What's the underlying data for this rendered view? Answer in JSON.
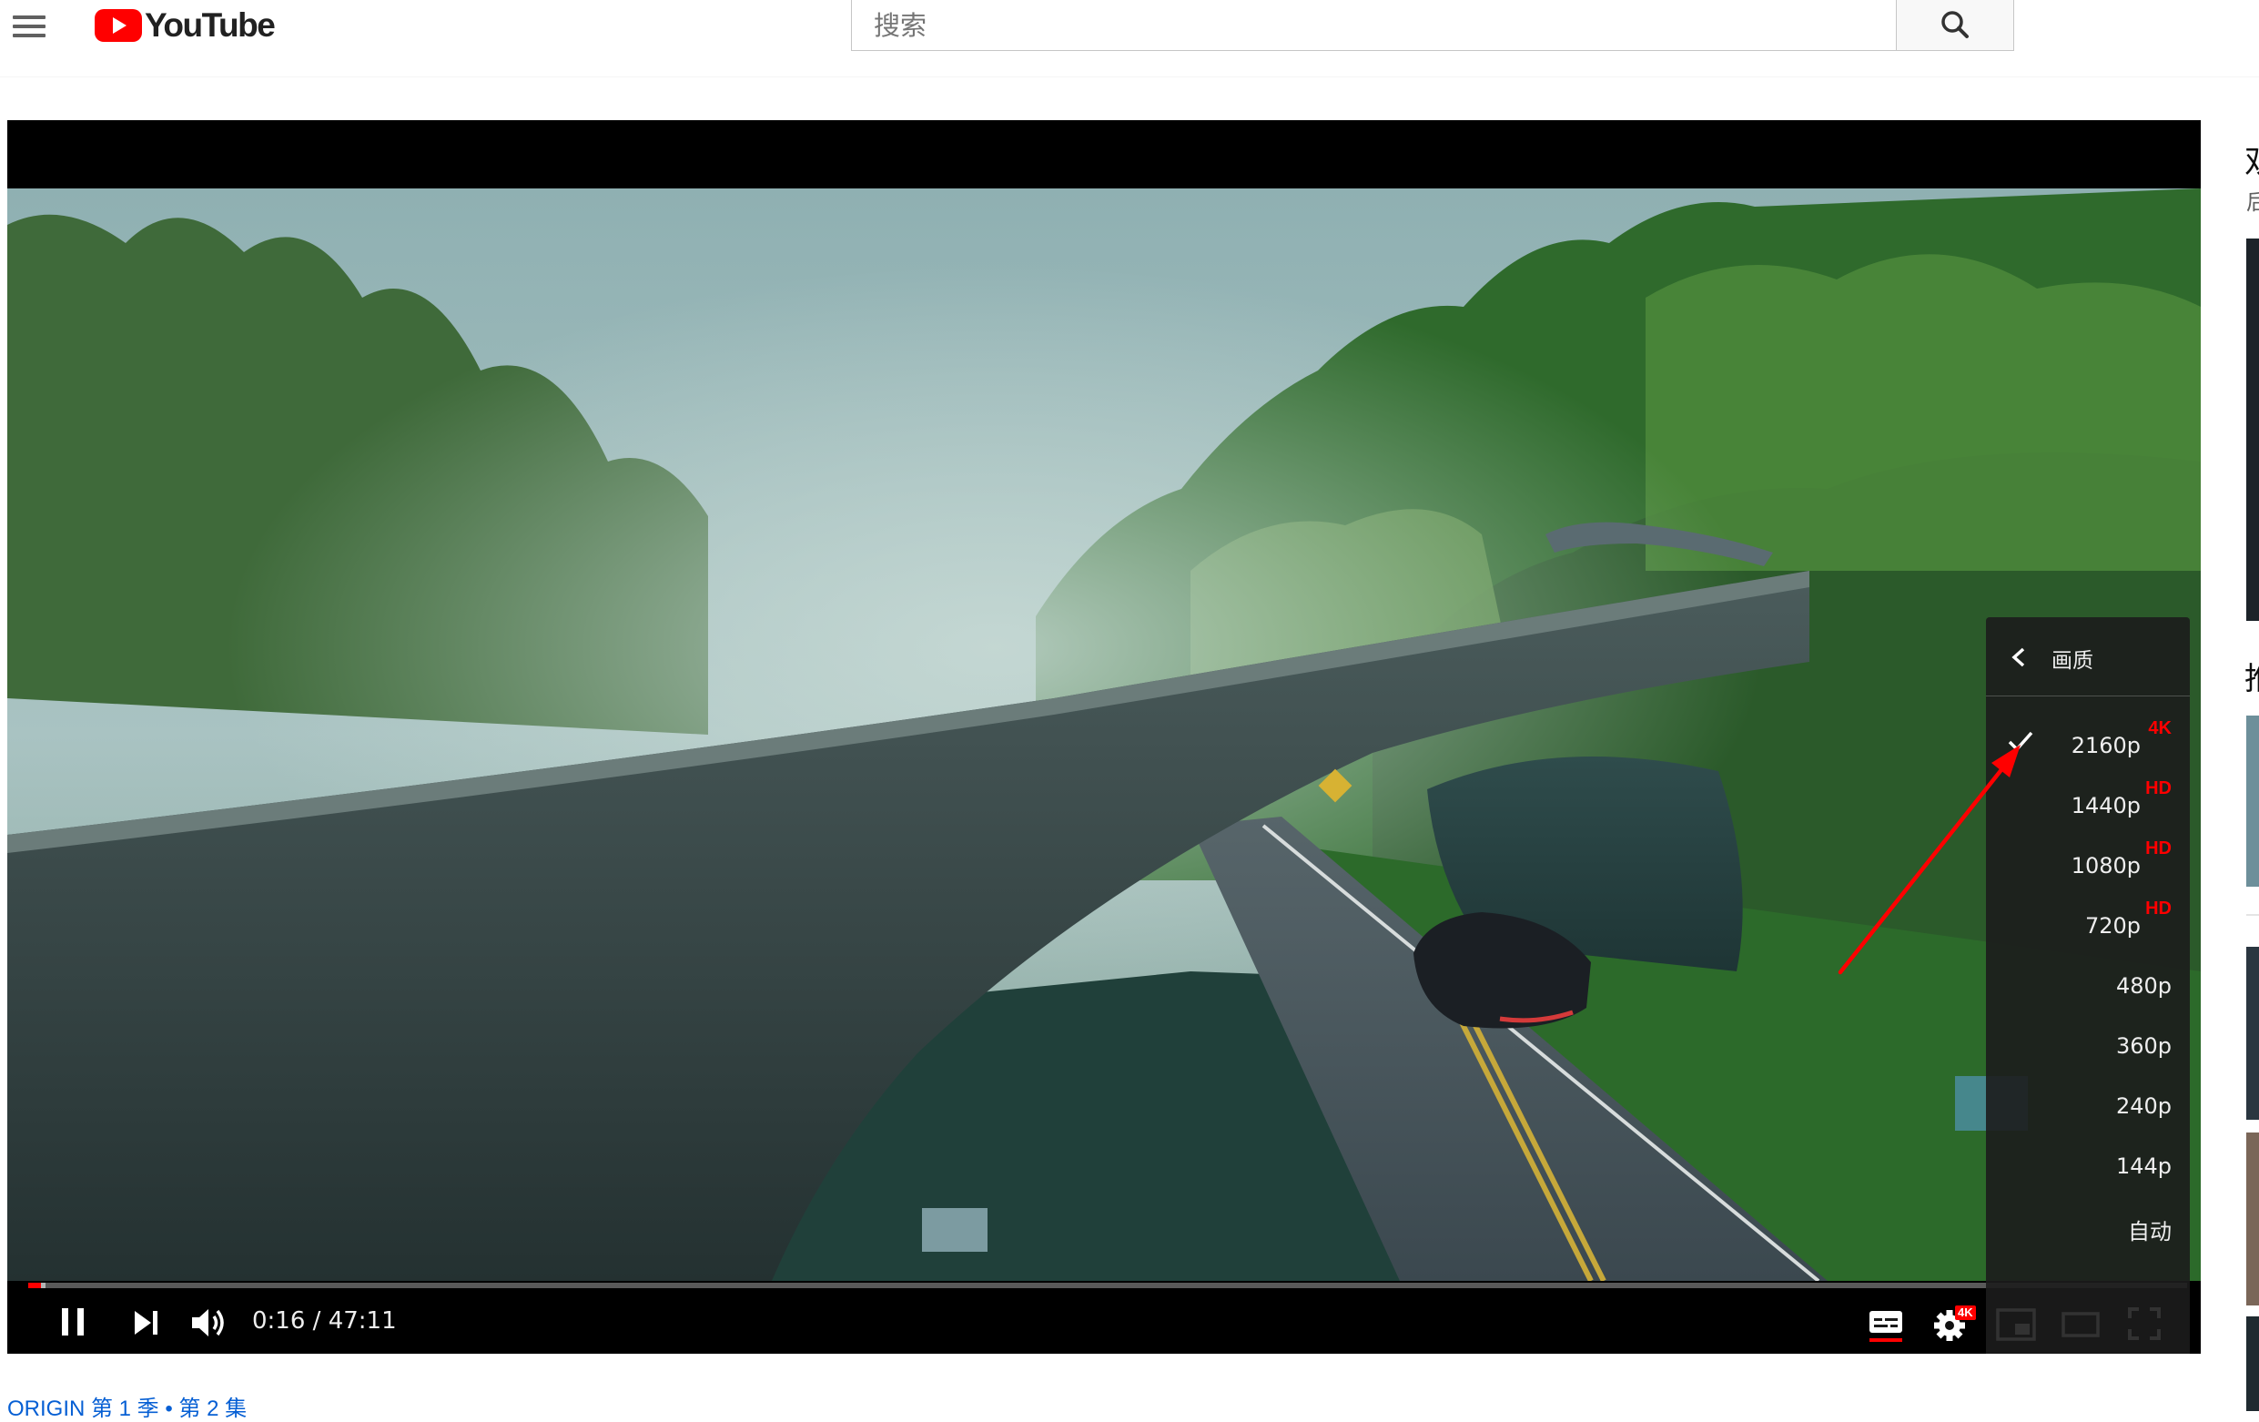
{
  "header": {
    "logo_text": "YouTube",
    "search_placeholder": "搜索"
  },
  "player": {
    "current_time": "0:16",
    "separator": " / ",
    "duration": "47:11",
    "progress_fraction": 0.006,
    "settings_badge": "4K"
  },
  "quality_menu": {
    "title": "画质",
    "options": [
      {
        "label": "2160p",
        "badge": "4K",
        "selected": true
      },
      {
        "label": "1440p",
        "badge": "HD"
      },
      {
        "label": "1080p",
        "badge": "HD"
      },
      {
        "label": "720p",
        "badge": "HD"
      },
      {
        "label": "480p"
      },
      {
        "label": "360p"
      },
      {
        "label": "240p"
      },
      {
        "label": "144p"
      },
      {
        "label": "自动"
      }
    ]
  },
  "below": {
    "breadcrumb": "ORIGIN 第 1 季 • 第 2 集"
  },
  "sidebar": {
    "heading_partial": "双",
    "sub_partial": "后",
    "heading2_partial": "推"
  },
  "colors": {
    "brand_red": "#ff0000",
    "link_blue": "#065fd4",
    "annotation_arrow": "#ff0000"
  }
}
